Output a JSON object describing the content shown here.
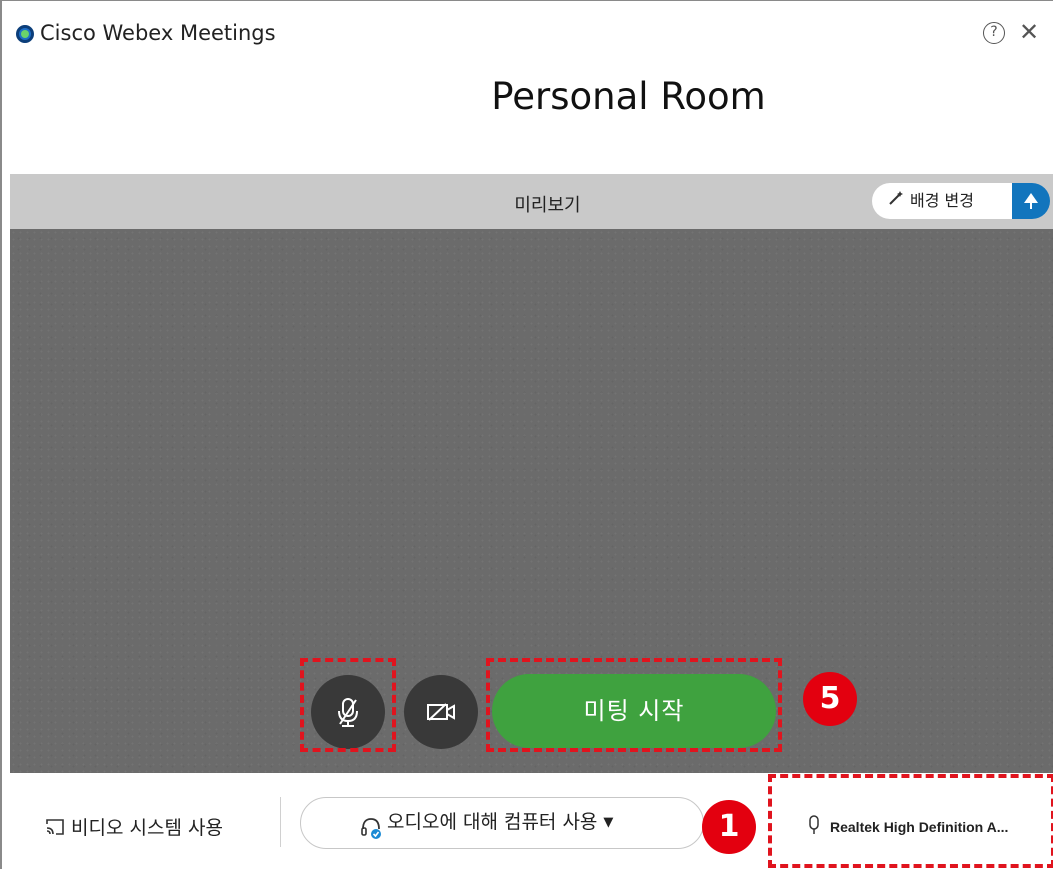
{
  "window": {
    "app_title": "Cisco Webex Meetings",
    "room_title": "Personal Room"
  },
  "preview": {
    "label": "미리보기",
    "background_button_label": "배경 변경"
  },
  "controls": {
    "start_meeting_label": "미팅 시작"
  },
  "bottom_bar": {
    "video_system_label": "비디오 시스템 사용",
    "audio_option_label": "오디오에 대해 컴퓨터 사용",
    "audio_device_label": "Realtek High Definition A..."
  },
  "annotations": {
    "badge_1": "1",
    "badge_5": "5"
  },
  "colors": {
    "accent_green": "#3fa23f",
    "toggle_blue": "#1275bd",
    "annotation_red": "#e0141e"
  }
}
